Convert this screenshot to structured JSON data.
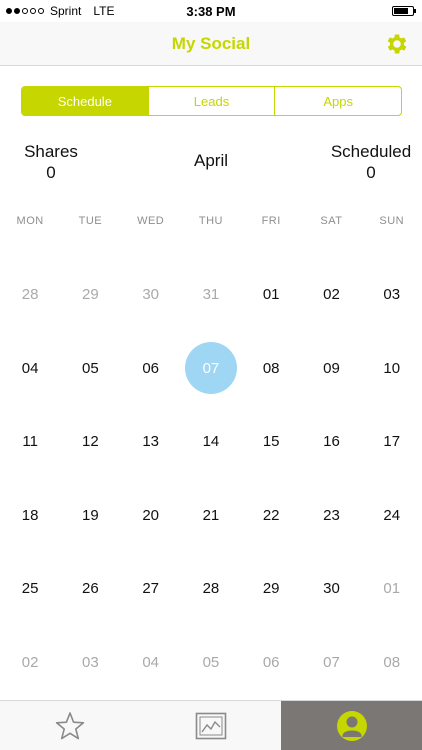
{
  "status_bar": {
    "carrier": "Sprint",
    "network": "LTE",
    "time": "3:38 PM"
  },
  "nav": {
    "title": "My Social",
    "settings_icon": "gear-icon"
  },
  "segments": [
    {
      "label": "Schedule",
      "active": true
    },
    {
      "label": "Leads",
      "active": false
    },
    {
      "label": "Apps",
      "active": false
    }
  ],
  "stats": {
    "shares_label": "Shares",
    "shares_value": "0",
    "scheduled_label": "Scheduled",
    "scheduled_value": "0"
  },
  "calendar": {
    "month": "April",
    "weekdays": [
      "MON",
      "TUE",
      "WED",
      "THU",
      "FRI",
      "SAT",
      "SUN"
    ],
    "weeks": [
      [
        {
          "d": "28",
          "m": true
        },
        {
          "d": "29",
          "m": true
        },
        {
          "d": "30",
          "m": true
        },
        {
          "d": "31",
          "m": true
        },
        {
          "d": "01"
        },
        {
          "d": "02"
        },
        {
          "d": "03"
        }
      ],
      [
        {
          "d": "04"
        },
        {
          "d": "05"
        },
        {
          "d": "06"
        },
        {
          "d": "07",
          "s": true
        },
        {
          "d": "08"
        },
        {
          "d": "09"
        },
        {
          "d": "10"
        }
      ],
      [
        {
          "d": "11"
        },
        {
          "d": "12"
        },
        {
          "d": "13"
        },
        {
          "d": "14"
        },
        {
          "d": "15"
        },
        {
          "d": "16"
        },
        {
          "d": "17"
        }
      ],
      [
        {
          "d": "18"
        },
        {
          "d": "19"
        },
        {
          "d": "20"
        },
        {
          "d": "21"
        },
        {
          "d": "22"
        },
        {
          "d": "23"
        },
        {
          "d": "24"
        }
      ],
      [
        {
          "d": "25"
        },
        {
          "d": "26"
        },
        {
          "d": "27"
        },
        {
          "d": "28"
        },
        {
          "d": "29"
        },
        {
          "d": "30"
        },
        {
          "d": "01",
          "m": true
        }
      ],
      [
        {
          "d": "02",
          "m": true
        },
        {
          "d": "03",
          "m": true
        },
        {
          "d": "04",
          "m": true
        },
        {
          "d": "05",
          "m": true
        },
        {
          "d": "06",
          "m": true
        },
        {
          "d": "07",
          "m": true
        },
        {
          "d": "08",
          "m": true
        }
      ]
    ]
  },
  "tabs": [
    {
      "icon": "star-icon",
      "active": false
    },
    {
      "icon": "image-chart-icon",
      "active": false
    },
    {
      "icon": "profile-icon",
      "active": true
    }
  ],
  "colors": {
    "accent": "#c5d600",
    "selected_day": "#9fd6f3",
    "tab_active": "#7b7775"
  }
}
